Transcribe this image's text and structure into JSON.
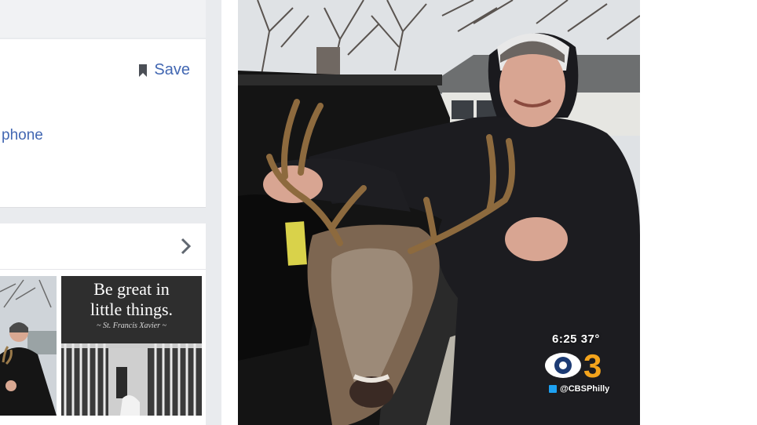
{
  "post_card": {
    "save_label": "Save",
    "phone_link": "phone"
  },
  "photos_card": {
    "quote": {
      "line1": "Be great in",
      "line2": "little things.",
      "attribution": "~ St. Francis Xavier ~"
    }
  },
  "broadcast_overlay": {
    "time_temp": "6:25 37°",
    "network_number": "3",
    "twitter_handle": "@CBSPhilly"
  },
  "colors": {
    "link_blue": "#4267b2",
    "cbs_gold": "#f4a41c",
    "twitter_blue": "#1da1f2"
  }
}
